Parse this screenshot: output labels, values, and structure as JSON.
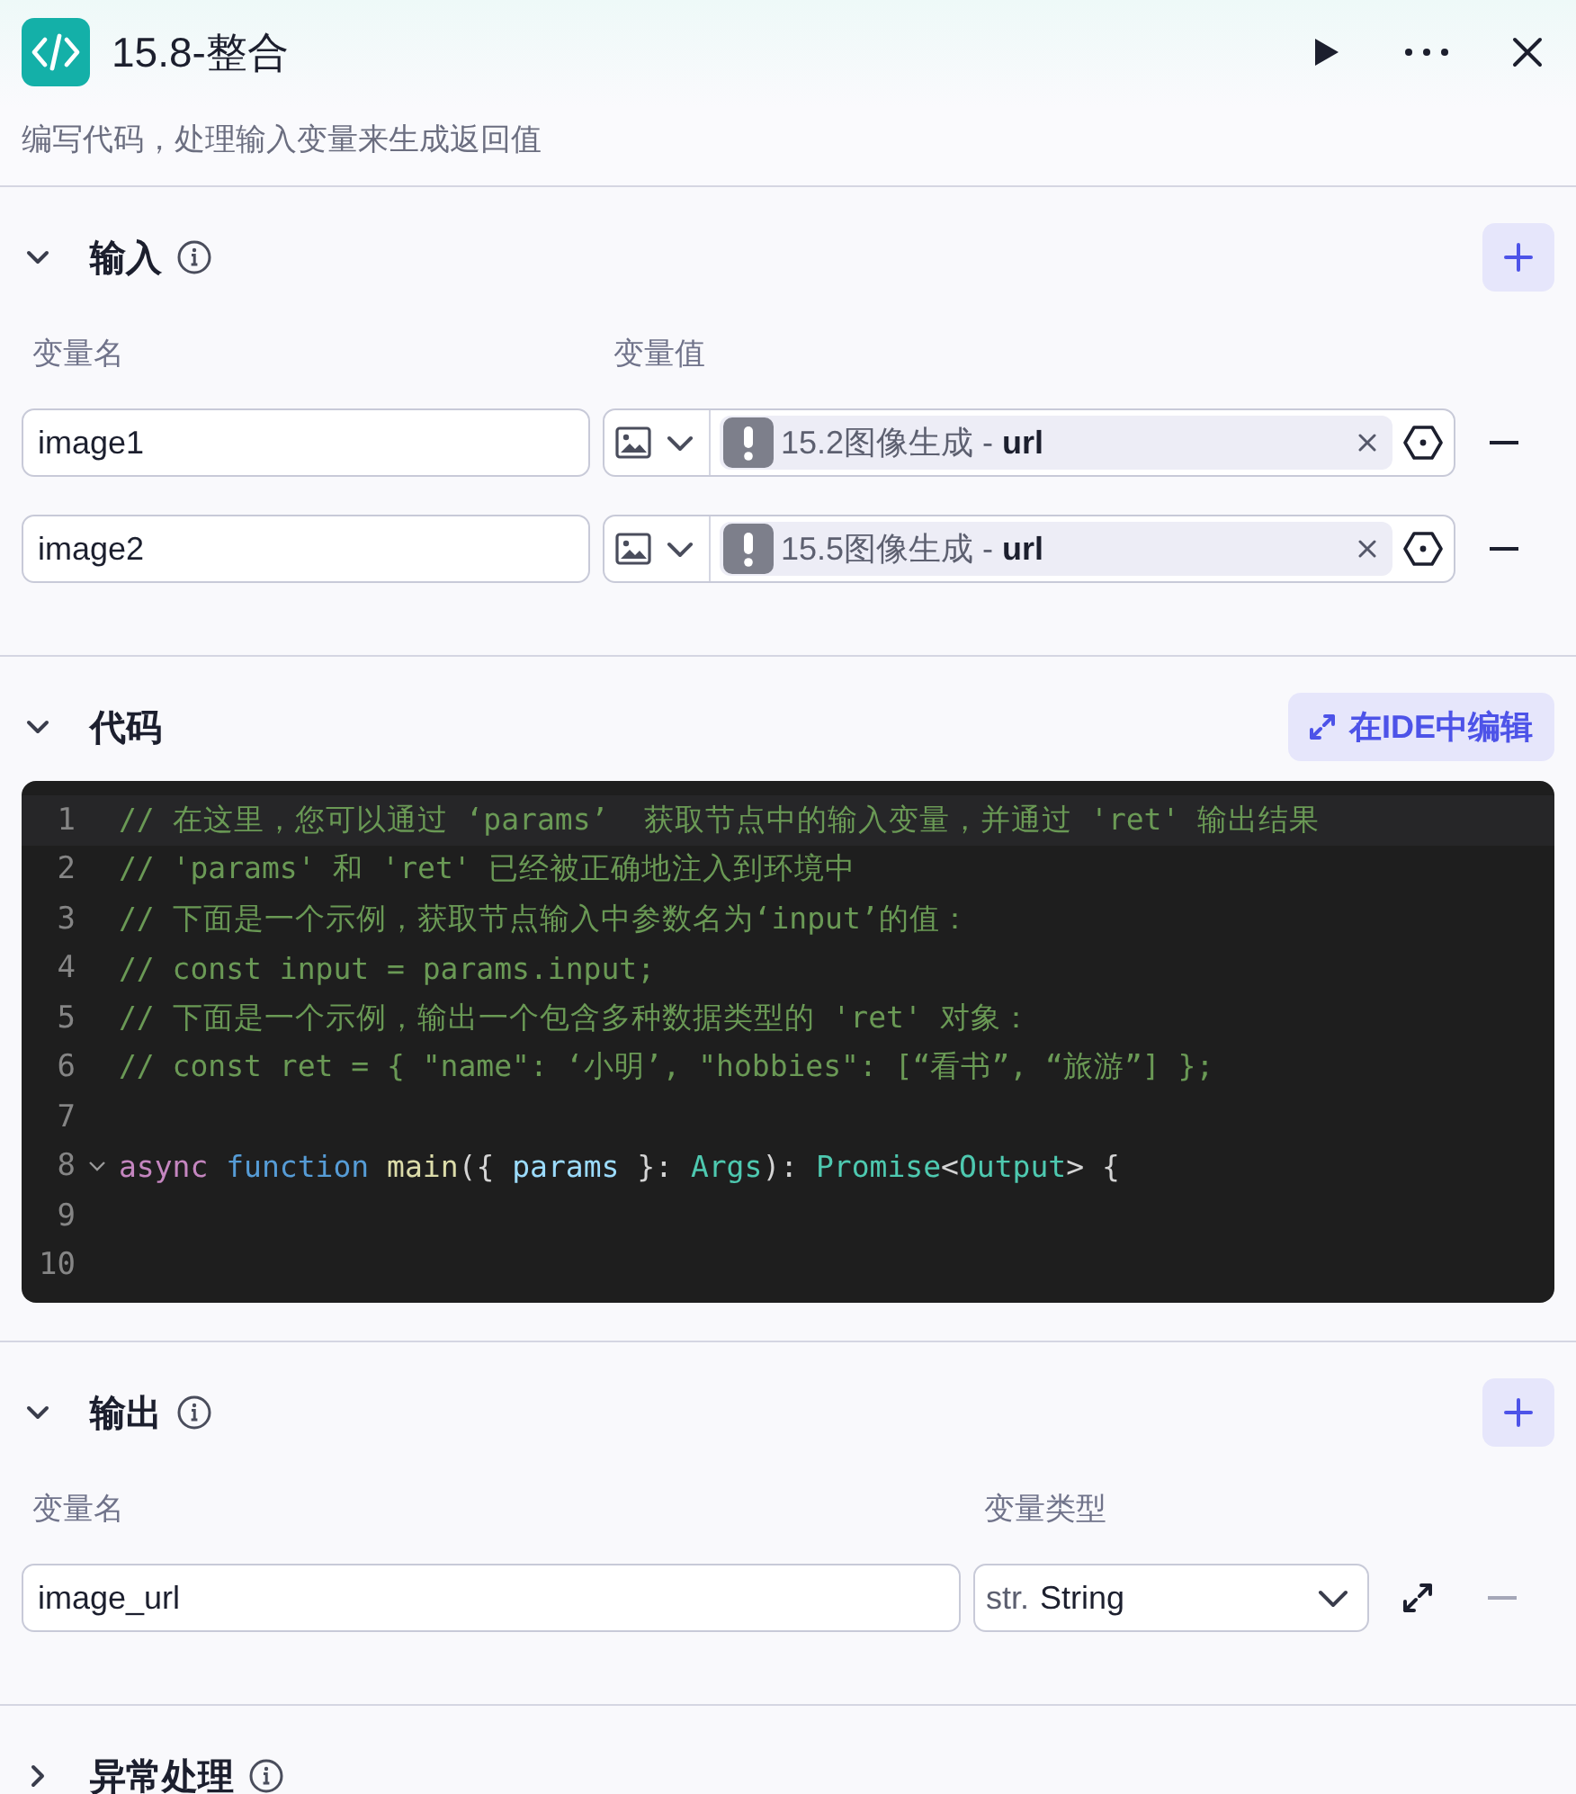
{
  "header": {
    "title": "15.8-整合",
    "description": "编写代码，处理输入变量来生成返回值"
  },
  "input": {
    "title": "输入",
    "expanded": true,
    "columns": [
      "变量名",
      "变量值"
    ],
    "rows": [
      {
        "name": "image1",
        "source": "15.2图像生成",
        "separator": " - ",
        "field": "url"
      },
      {
        "name": "image2",
        "source": "15.5图像生成",
        "separator": " - ",
        "field": "url"
      }
    ]
  },
  "code": {
    "title": "代码",
    "expanded": true,
    "ide_button": "在IDE中编辑",
    "lines": [
      {
        "number": "1",
        "current": true,
        "tokens": [
          {
            "kind": "comment",
            "text": "// 在这里，您可以通过 ‘params’  获取节点中的输入变量，并通过 'ret' 输出结果"
          }
        ]
      },
      {
        "number": "2",
        "tokens": [
          {
            "kind": "comment",
            "text": "// 'params' 和 'ret' 已经被正确地注入到环境中"
          }
        ]
      },
      {
        "number": "3",
        "tokens": [
          {
            "kind": "comment",
            "text": "// 下面是一个示例，获取节点输入中参数名为‘input’的值："
          }
        ]
      },
      {
        "number": "4",
        "tokens": [
          {
            "kind": "comment",
            "text": "// const input = params.input;"
          }
        ]
      },
      {
        "number": "5",
        "tokens": [
          {
            "kind": "comment",
            "text": "// 下面是一个示例，输出一个包含多种数据类型的 'ret' 对象："
          }
        ]
      },
      {
        "number": "6",
        "tokens": [
          {
            "kind": "comment",
            "text": "// const ret = { \"name\": ‘小明’, \"hobbies\": [“看书”, “旅游”] };"
          }
        ]
      },
      {
        "number": "7"
      },
      {
        "number": "8",
        "foldable": true,
        "tokens": [
          {
            "kind": "keyword",
            "text": "async "
          },
          {
            "kind": "storage",
            "text": "function "
          },
          {
            "kind": "function",
            "text": "main"
          },
          {
            "kind": "plain",
            "text": "({ "
          },
          {
            "kind": "param",
            "text": "params"
          },
          {
            "kind": "plain",
            "text": " }: "
          },
          {
            "kind": "type",
            "text": "Args"
          },
          {
            "kind": "plain",
            "text": "): "
          },
          {
            "kind": "type",
            "text": "Promise"
          },
          {
            "kind": "plain",
            "text": "<"
          },
          {
            "kind": "type",
            "text": "Output"
          },
          {
            "kind": "plain",
            "text": "> {"
          }
        ]
      },
      {
        "number": "9"
      },
      {
        "number": "10"
      }
    ]
  },
  "output": {
    "title": "输出",
    "expanded": true,
    "columns": [
      "变量名",
      "变量类型"
    ],
    "rows": [
      {
        "name": "image_url",
        "type_prefix": "str.",
        "type": "String"
      }
    ]
  },
  "error_handling": {
    "title": "异常处理",
    "expanded": false
  }
}
